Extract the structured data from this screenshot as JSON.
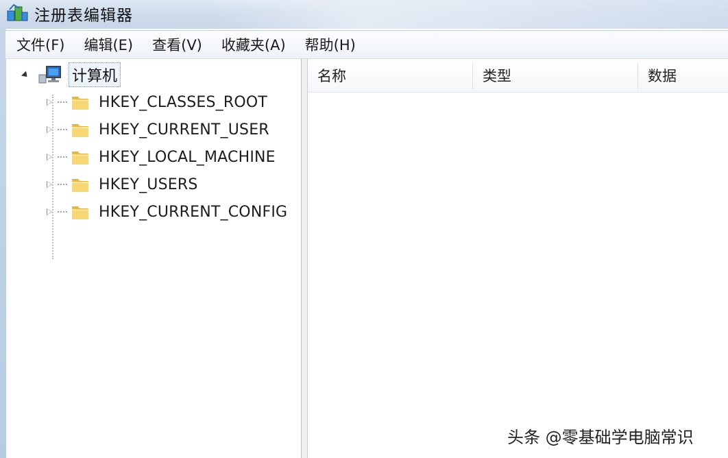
{
  "window": {
    "title": "注册表编辑器",
    "icon": "registry-editor-icon"
  },
  "menu": [
    {
      "label": "文件(F)"
    },
    {
      "label": "编辑(E)"
    },
    {
      "label": "查看(V)"
    },
    {
      "label": "收藏夹(A)"
    },
    {
      "label": "帮助(H)"
    }
  ],
  "tree": {
    "root": {
      "label": "计算机",
      "icon": "computer-icon",
      "expanded": true
    },
    "nodes": [
      {
        "label": "HKEY_CLASSES_ROOT",
        "icon": "folder-icon"
      },
      {
        "label": "HKEY_CURRENT_USER",
        "icon": "folder-icon"
      },
      {
        "label": "HKEY_LOCAL_MACHINE",
        "icon": "folder-icon"
      },
      {
        "label": "HKEY_USERS",
        "icon": "folder-icon"
      },
      {
        "label": "HKEY_CURRENT_CONFIG",
        "icon": "folder-icon"
      }
    ]
  },
  "list": {
    "columns": [
      {
        "label": "名称"
      },
      {
        "label": "类型"
      },
      {
        "label": "数据"
      }
    ]
  },
  "watermark": "头条 @零基础学电脑常识",
  "colors": {
    "folder": "#f2c94c",
    "titlebar": "#cfdceb",
    "selection_outline": "#7a8fa8"
  }
}
